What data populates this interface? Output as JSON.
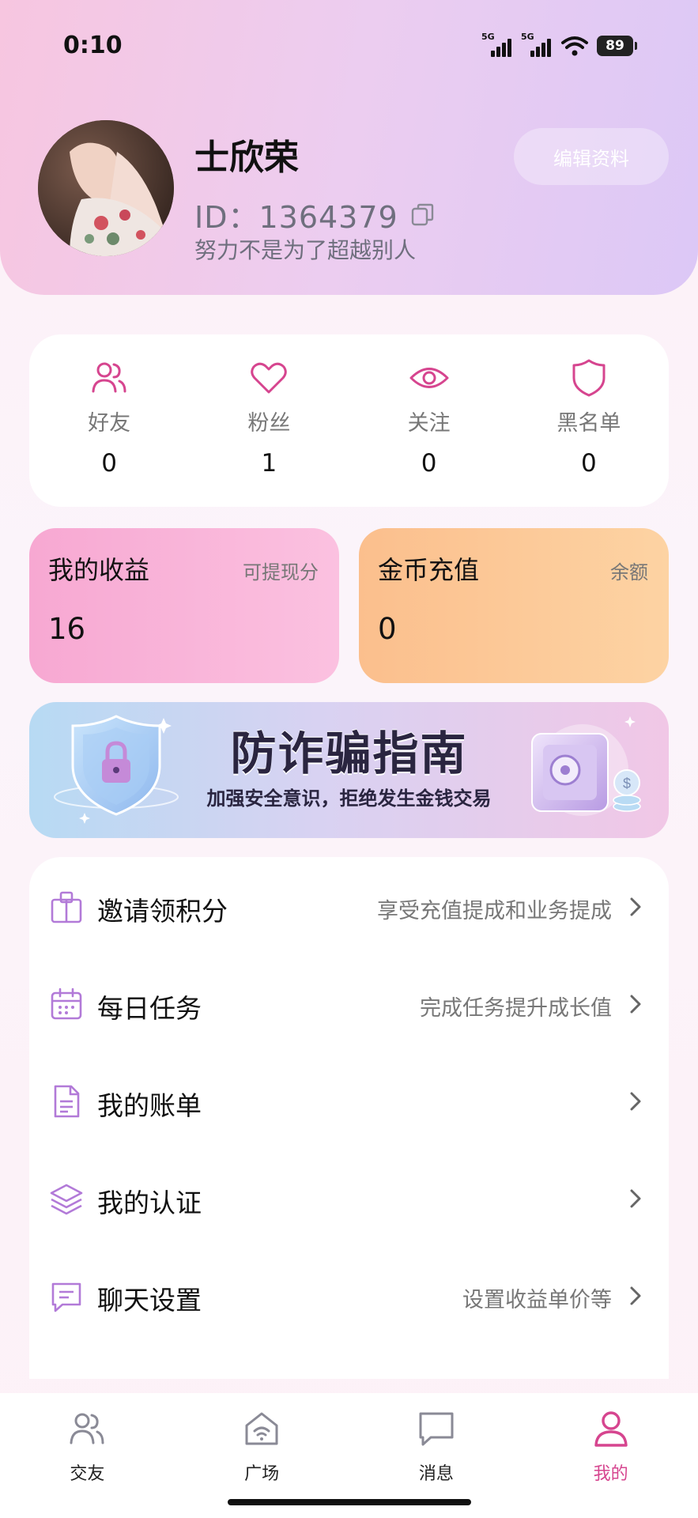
{
  "status_bar": {
    "time": "0:10",
    "network_1": "5G",
    "network_2": "5G",
    "battery": "89"
  },
  "profile": {
    "nickname": "士欣荣",
    "user_id": "ID：1364379",
    "signature": "努力不是为了超越别人",
    "edit_button": "编辑资料"
  },
  "stats": [
    {
      "label": "好友",
      "value": "0",
      "icon": "users-icon"
    },
    {
      "label": "粉丝",
      "value": "1",
      "icon": "heart-icon"
    },
    {
      "label": "关注",
      "value": "0",
      "icon": "eye-icon"
    },
    {
      "label": "黑名单",
      "value": "0",
      "icon": "shield-icon"
    }
  ],
  "wallet": {
    "earnings": {
      "title": "我的收益",
      "subtitle": "可提现分",
      "amount": "16"
    },
    "coins": {
      "title": "金币充值",
      "subtitle": "余额",
      "amount": "0"
    }
  },
  "banner": {
    "title": "防诈骗指南",
    "subtitle": "加强安全意识，拒绝发生金钱交易"
  },
  "menu": [
    {
      "label": "邀请领积分",
      "hint": "享受充值提成和业务提成",
      "icon": "gift-box-icon"
    },
    {
      "label": "每日任务",
      "hint": "完成任务提升成长值",
      "icon": "calendar-icon"
    },
    {
      "label": "我的账单",
      "hint": "",
      "icon": "document-icon"
    },
    {
      "label": "我的认证",
      "hint": "",
      "icon": "layers-icon"
    },
    {
      "label": "聊天设置",
      "hint": "设置收益单价等",
      "icon": "chat-bubble-icon"
    }
  ],
  "tabs": [
    {
      "label": "交友",
      "icon": "users-icon",
      "active": false
    },
    {
      "label": "广场",
      "icon": "home-signal-icon",
      "active": false
    },
    {
      "label": "消息",
      "icon": "message-icon",
      "active": false
    },
    {
      "label": "我的",
      "icon": "person-icon",
      "active": true
    }
  ],
  "colors": {
    "accent_pink": "#d6458f",
    "icon_purple": "#b27ad8",
    "earnings_card": "#f7a8d2",
    "coins_card": "#fbbf8d"
  }
}
